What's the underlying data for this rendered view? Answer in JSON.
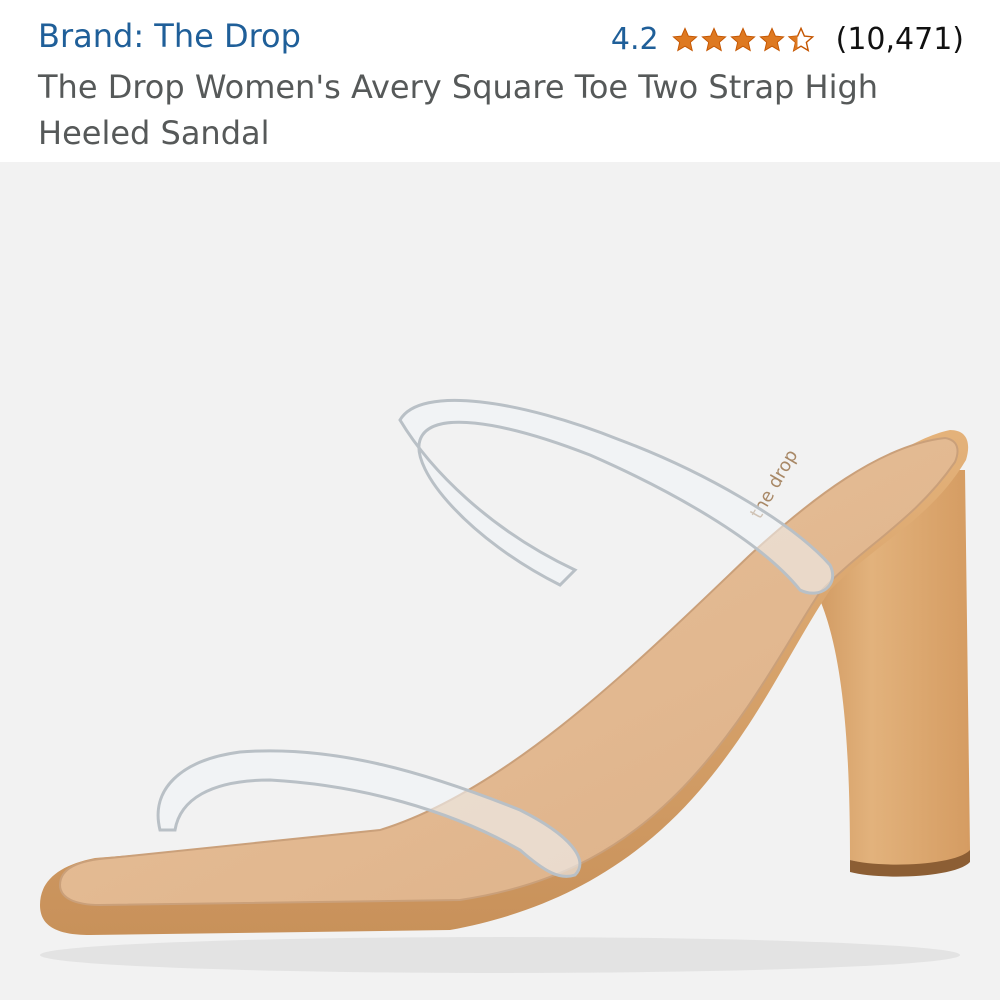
{
  "header": {
    "brand_link": "Brand: The Drop",
    "rating_value": "4.2",
    "rating_count": "(10,471)",
    "product_title": "The Drop Women's Avery Square Toe Two Strap High Heeled Sandal"
  },
  "rating": {
    "stars_value": 4.2,
    "stars_max": 5,
    "star_color": "#de7921"
  },
  "colors": {
    "link": "#1f5f99",
    "title": "#565959",
    "image_bg": "#f2f2f2",
    "sandal_tan": "#d9a66e"
  },
  "product_image": {
    "insole_print": "the drop"
  }
}
